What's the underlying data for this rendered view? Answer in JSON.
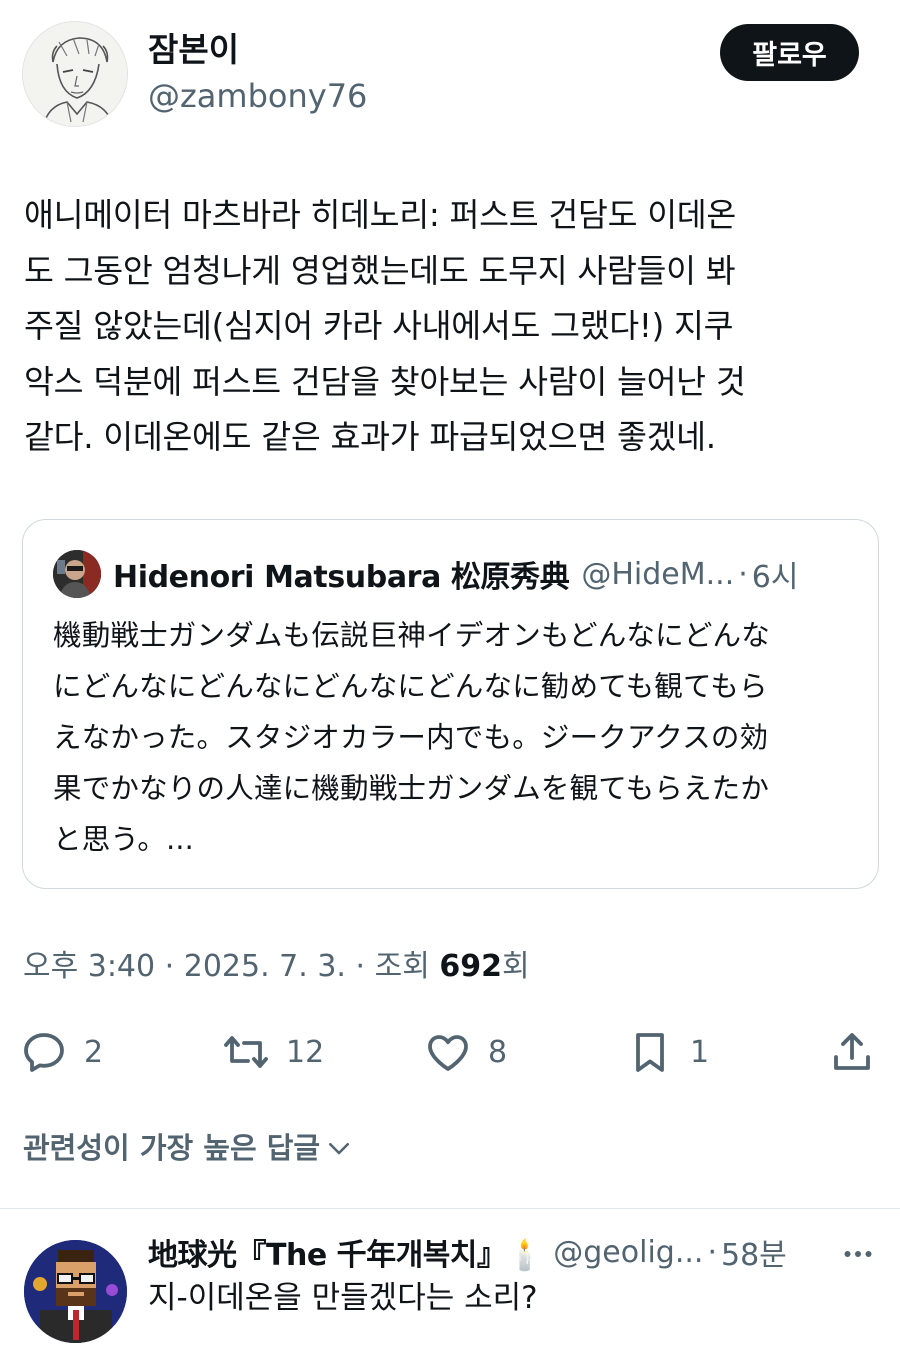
{
  "tweet": {
    "display_name": "잠본이",
    "handle": "@zambony76",
    "follow_label": "팔로우",
    "text_lines": [
      "애니메이터 마츠바라 히데노리: 퍼스트 건담도 이데온",
      "도 그동안 엄청나게 영업했는데도 도무지 사람들이 봐",
      "주질 않았는데(심지어 카라 사내에서도 그랬다!) 지쿠",
      "악스 덕분에 퍼스트 건담을 찾아보는 사람이 늘어난 것",
      "같다. 이데온에도 같은 효과가 파급되었으면 좋겠네."
    ]
  },
  "quote": {
    "name": "Hidenori Matsubara 松原秀典",
    "handle": "@HideM...",
    "separator": "·",
    "time": "6시",
    "text_lines": [
      "機動戦士ガンダムも伝説巨神イデオンもどんなにどんな",
      "にどんなにどんなにどんなにどんなに勧めても観てもら",
      "えなかった。スタジオカラー内でも。ジークアクスの効",
      "果でかなりの人達に機動戦士ガンダムを観てもらえたか",
      "と思う。..."
    ]
  },
  "meta": {
    "time": "오후 3:40",
    "sep1": "·",
    "date": "2025. 7. 3.",
    "sep2": "·",
    "views_prefix": "조회",
    "views_count": "692",
    "views_suffix": "회"
  },
  "actions": {
    "reply_count": "2",
    "retweet_count": "12",
    "like_count": "8",
    "bookmark_count": "1"
  },
  "replies_section": {
    "label": "관련성이 가장 높은 답글"
  },
  "reply": {
    "name": "地球光『The 千年개복치』🕯️",
    "handle": "@geolig...",
    "separator": "·",
    "time": "58분",
    "text": "지-이데온을 만들겠다는 소리?"
  },
  "colors": {
    "text": "#0f1419",
    "secondary": "#536471",
    "border": "#cfd9de",
    "button": "#0f1419"
  }
}
